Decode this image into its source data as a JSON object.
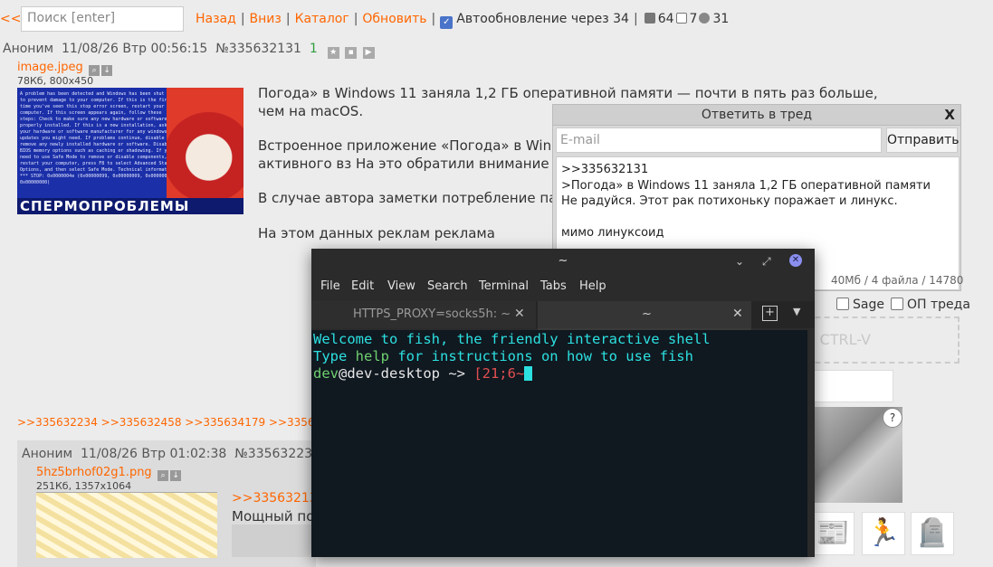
{
  "nav": {
    "prev": "<<",
    "search_placeholder": "Поиск [enter]",
    "links": [
      "Назад",
      "Вниз",
      "Каталог",
      "Обновить"
    ],
    "autoupdate": "Автообновление через 34",
    "stats": {
      "posts": "64",
      "images": "7",
      "users": "31"
    }
  },
  "post1": {
    "author": "Аноним",
    "date": "11/08/26 Втр 00:56:15",
    "num": "№335632131",
    "count": "1",
    "file": {
      "name": "image.jpeg",
      "meta": "78Кб, 800x450"
    },
    "image_text": "СПЕРМОПРОБЛЕМЫ",
    "image_small_text": "A problem has been detected and Windows has been shut down to prevent damage to your computer.\nIf this is the first time you've seen this stop error screen, restart your computer. If this screen appears again, follow these steps:\nCheck to make sure any new hardware or software is properly installed. If this is a new installation, ask your hardware or software manufacturer for any windows updates you might need.\nIf problems continue, disable or remove any newly installed hardware or software. Disable BIOS memory options such as caching or shadowing. If you need to use Safe Mode to remove or disable components, restart your computer, press F8 to select Advanced Startup Options, and then select Safe Mode.\nTechnical information:\n*** STOP: 0x0000004e (0x00000099, 0x00000009, 0x00000000, 0x00000000)",
    "paragraphs": [
      "Погода» в Windows 11 заняла 1,2 ГБ оперативной памяти — почти в пять раз больше, чем на macOS.",
      "Встроенное приложение «Погода» в Windows оперативной памяти даже без активного вз На это обратили внимание в Windows Latest приложения.",
      "В случае автора заметки потребление памя прокруч отображ Как отме интерфе",
      "На этом данных реклам реклама"
    ],
    "replies": ">>335632234 >>335632458 >>335634179 >>335635170 >>"
  },
  "post2": {
    "author": "Аноним",
    "date": "11/08/26 Втр 01:02:38",
    "num": "№335632234",
    "count": "2",
    "file": {
      "name": "5hz5brhof02g1.png",
      "meta": "251Кб, 1357x1064"
    },
    "quote": ">>33563213",
    "text": "Мощный по"
  },
  "reply_form": {
    "title": "Ответить в тред",
    "close": "X",
    "email_placeholder": "E-mail",
    "send": "Отправить",
    "text": ">>335632131\n>Погода» в Windows 11 заняла 1,2 ГБ оперативной памяти\nНе радуйся. Этот рак потихоньку поражает и линукс.\n\nмимо линуксоид",
    "limits": "40Мб / 4 файла / 14780",
    "sage": "Sage",
    "op": "ОП треда",
    "dropzone": "CTRL-V",
    "captcha_help": "?"
  },
  "terminal": {
    "title": "~",
    "menu": [
      "File",
      "Edit",
      "View",
      "Search",
      "Terminal",
      "Tabs",
      "Help"
    ],
    "tabs": [
      "HTTPS_PROXY=socks5h: ~",
      "~"
    ],
    "line1": "Welcome to fish, the friendly interactive shell",
    "line2a": "Type ",
    "line2b": "help",
    "line2c": " for instructions on how to use fish",
    "prompt_user": "dev",
    "prompt_host": "@dev-desktop",
    "prompt_sym": " ~> ",
    "input": "[21;6~"
  }
}
